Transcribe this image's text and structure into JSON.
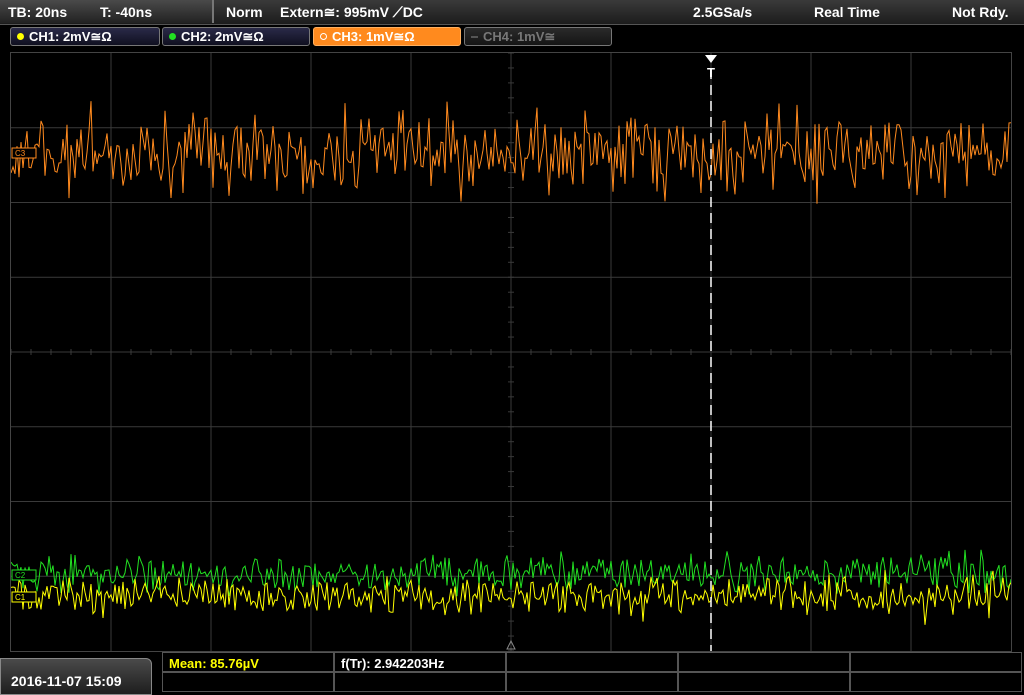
{
  "topbar": {
    "timebase": "TB: 20ns",
    "trigger_offset": "T: -40ns",
    "mode": "Norm",
    "trigger_source": "Extern≅: 995mV ⟋DC",
    "sample_rate": "2.5GSa/s",
    "acq_mode": "Real Time",
    "status": "Not Rdy."
  },
  "channels": [
    {
      "label": "CH1: 2mV≅Ω",
      "color": "#ffff00",
      "state": "on"
    },
    {
      "label": "CH2: 2mV≅Ω",
      "color": "#00e000",
      "state": "on"
    },
    {
      "label": "CH3: 1mV≅Ω",
      "color": "#ff8a1e",
      "state": "active"
    },
    {
      "label": "CH4: 1mV≅",
      "color": "#777777",
      "state": "off"
    }
  ],
  "screen": {
    "trigger_marker": "T",
    "ch3_marker": "C3",
    "ch2_marker": "C2",
    "ch1_marker": "C1",
    "colors": {
      "ch1": "#ffff00",
      "ch2": "#22e022",
      "ch3": "#ff8a1e",
      "grid": "#3a3a3a"
    }
  },
  "bottom": {
    "datetime": "2016-11-07 15:09",
    "mean": "Mean: 85.76µV",
    "frequency": "f(Tr): 2.942203Hz"
  }
}
